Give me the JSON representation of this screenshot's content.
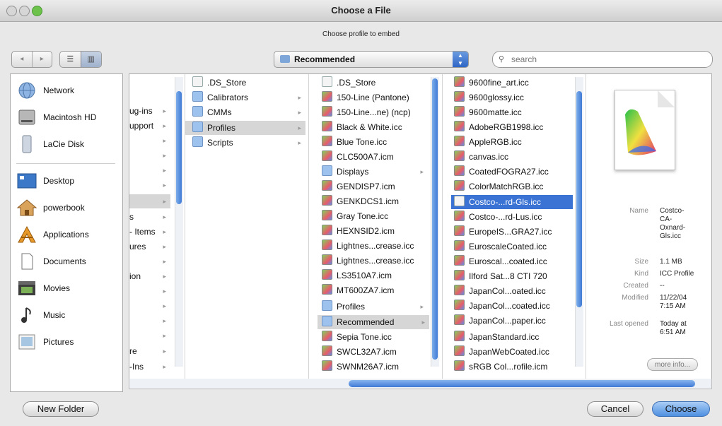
{
  "window": {
    "title": "Choose a File",
    "prompt": "Choose profile to embed"
  },
  "toolbar": {
    "nav_back": "◂",
    "nav_forward": "▸",
    "view_list": "☰",
    "view_columns": "▥",
    "location": "Recommended",
    "search_placeholder": "search"
  },
  "sidebar": {
    "devices": [
      {
        "label": "Network",
        "icon": "network-globe-icon"
      },
      {
        "label": "Macintosh HD",
        "icon": "hard-drive-icon"
      },
      {
        "label": "LaCie Disk",
        "icon": "external-disk-icon"
      }
    ],
    "places": [
      {
        "label": "Desktop",
        "icon": "desktop-icon"
      },
      {
        "label": "powerbook",
        "icon": "home-icon"
      },
      {
        "label": "Applications",
        "icon": "applications-icon"
      },
      {
        "label": "Documents",
        "icon": "documents-icon"
      },
      {
        "label": "Movies",
        "icon": "movies-icon"
      },
      {
        "label": "Music",
        "icon": "music-icon"
      },
      {
        "label": "Pictures",
        "icon": "pictures-icon"
      }
    ]
  },
  "col0": [
    {
      "label": "",
      "arrow": ""
    },
    {
      "label": "",
      "arrow": ""
    },
    {
      "label": "ug-ins",
      "arrow": "▸"
    },
    {
      "label": "upport",
      "arrow": "▸"
    },
    {
      "label": "",
      "arrow": "▸"
    },
    {
      "label": "",
      "arrow": "▸"
    },
    {
      "label": "",
      "arrow": "▸"
    },
    {
      "label": "",
      "arrow": "▸"
    },
    {
      "label": "",
      "arrow": "▸"
    },
    {
      "label": "s",
      "arrow": "▸"
    },
    {
      "label": "- Items",
      "arrow": "▸"
    },
    {
      "label": "ures",
      "arrow": "▸"
    },
    {
      "label": "",
      "arrow": "▸"
    },
    {
      "label": "ion",
      "arrow": "▸"
    },
    {
      "label": "",
      "arrow": "▸"
    },
    {
      "label": "",
      "arrow": "▸"
    },
    {
      "label": "",
      "arrow": "▸"
    },
    {
      "label": "",
      "arrow": "▸"
    },
    {
      "label": "re",
      "arrow": "▸"
    },
    {
      "label": "-Ins",
      "arrow": "▸"
    }
  ],
  "col1": [
    {
      "label": ".DS_Store",
      "kind": "file",
      "arrow": ""
    },
    {
      "label": "Calibrators",
      "kind": "folder",
      "arrow": "▸"
    },
    {
      "label": "CMMs",
      "kind": "folder",
      "arrow": "▸"
    },
    {
      "label": "Profiles",
      "kind": "folder",
      "arrow": "▸"
    },
    {
      "label": "Scripts",
      "kind": "folder",
      "arrow": "▸"
    }
  ],
  "col2": [
    {
      "label": ".DS_Store",
      "kind": "file",
      "arrow": ""
    },
    {
      "label": "150-Line (Pantone)",
      "kind": "icc",
      "arrow": ""
    },
    {
      "label": "150-Line...ne) (ncp)",
      "kind": "icc",
      "arrow": ""
    },
    {
      "label": "Black & White.icc",
      "kind": "icc",
      "arrow": ""
    },
    {
      "label": "Blue Tone.icc",
      "kind": "icc",
      "arrow": ""
    },
    {
      "label": "CLC500A7.icm",
      "kind": "icc",
      "arrow": ""
    },
    {
      "label": "Displays",
      "kind": "folder",
      "arrow": "▸"
    },
    {
      "label": "GENDISP7.icm",
      "kind": "icc",
      "arrow": ""
    },
    {
      "label": "GENKDCS1.icm",
      "kind": "icc",
      "arrow": ""
    },
    {
      "label": "Gray Tone.icc",
      "kind": "icc",
      "arrow": ""
    },
    {
      "label": "HEXNSID2.icm",
      "kind": "icc",
      "arrow": ""
    },
    {
      "label": "Lightnes...crease.icc",
      "kind": "icc",
      "arrow": ""
    },
    {
      "label": "Lightnes...crease.icc",
      "kind": "icc",
      "arrow": ""
    },
    {
      "label": "LS3510A7.icm",
      "kind": "icc",
      "arrow": ""
    },
    {
      "label": "MT600ZA7.icm",
      "kind": "icc",
      "arrow": ""
    },
    {
      "label": "Profiles",
      "kind": "folder",
      "arrow": "▸"
    },
    {
      "label": "Recommended",
      "kind": "folder",
      "arrow": "▸"
    },
    {
      "label": "Sepia Tone.icc",
      "kind": "icc",
      "arrow": ""
    },
    {
      "label": "SWCL32A7.icm",
      "kind": "icc",
      "arrow": ""
    },
    {
      "label": "SWNM26A7.icm",
      "kind": "icc",
      "arrow": ""
    }
  ],
  "col3": [
    {
      "label": "9600fine_art.icc"
    },
    {
      "label": "9600glossy.icc"
    },
    {
      "label": "9600matte.icc"
    },
    {
      "label": "AdobeRGB1998.icc"
    },
    {
      "label": "AppleRGB.icc"
    },
    {
      "label": "canvas.icc"
    },
    {
      "label": "CoatedFOGRA27.icc"
    },
    {
      "label": "ColorMatchRGB.icc"
    },
    {
      "label": "Costco-...rd-Gls.icc"
    },
    {
      "label": "Costco-...rd-Lus.icc"
    },
    {
      "label": "EuropeIS...GRA27.icc"
    },
    {
      "label": "EuroscaleCoated.icc"
    },
    {
      "label": "Euroscal...coated.icc"
    },
    {
      "label": "Ilford Sat...8 CTI 720"
    },
    {
      "label": "JapanCol...oated.icc"
    },
    {
      "label": "JapanCol...coated.icc"
    },
    {
      "label": "JapanCol...paper.icc"
    },
    {
      "label": "JapanStandard.icc"
    },
    {
      "label": "JapanWebCoated.icc"
    },
    {
      "label": "sRGB Col...rofile.icm"
    }
  ],
  "preview": {
    "name_label": "Name",
    "name_value": "Costco-\nCA-\nOxnard-\nGls.icc",
    "size_label": "Size",
    "size_value": "1.1 MB",
    "kind_label": "Kind",
    "kind_value": "ICC Profile",
    "created_label": "Created",
    "created_value": "--",
    "modified_label": "Modified",
    "modified_value": "11/22/04\n7:15 AM",
    "opened_label": "Last opened",
    "opened_value": "Today at\n6:51 AM",
    "more_info": "more info..."
  },
  "footer": {
    "new_folder": "New Folder",
    "cancel": "Cancel",
    "choose": "Choose"
  },
  "colors": {
    "selection": "#3a73d4",
    "scroll_thumb": "#3f7ad5",
    "default_button": "#4e8fe0"
  }
}
